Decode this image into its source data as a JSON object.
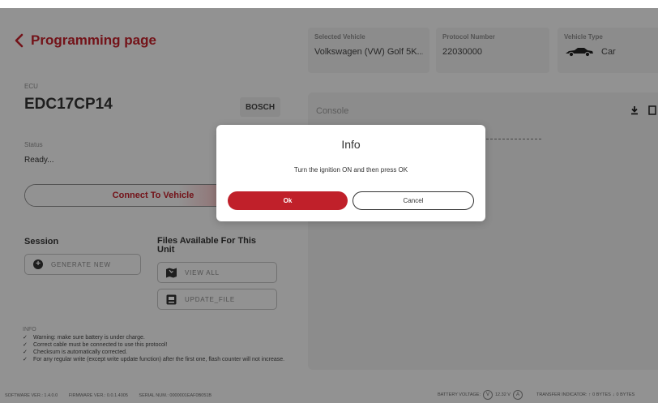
{
  "header": {
    "title": "Programming page",
    "selected_vehicle": {
      "label": "Selected Vehicle",
      "value": "Volkswagen (VW) Golf 5K..."
    },
    "protocol_number": {
      "label": "Protocol Number",
      "value": "22030000"
    },
    "vehicle_type": {
      "label": "Vehicle Type",
      "value": "Car",
      "icon": "car-icon"
    }
  },
  "ecu": {
    "label": "ECU",
    "name": "EDC17CP14",
    "brand": "BOSCH"
  },
  "status": {
    "label": "Status",
    "value": "Ready..."
  },
  "connect_button": {
    "label": "Connect To Vehicle",
    "progress": 1.0
  },
  "session": {
    "title": "Session",
    "generate_label": "GENERATE NEW"
  },
  "files": {
    "title": "Files Available For This Unit",
    "view_all_label": "VIEW ALL",
    "update_file_label": "UPDATE_FILE"
  },
  "info": {
    "label": "INFO",
    "lines": [
      "Warning: make sure battery is under charge.",
      "Correct cable must be connected to use this protocol!",
      "Checksum is automatically corrected.",
      "For any regular write (except write update function) after the first one, flash counter will not increase."
    ]
  },
  "console": {
    "title": "Console"
  },
  "footer": {
    "software": "SOFTWARE VER.: 1.4.0.0",
    "firmware": "FIRMWARE VER.: 0.0.1.4005",
    "serial": "SERIAL NUM.: 0000001EAF0B051B",
    "battery_label": "BATTERY VOLTAGE:",
    "battery_value": "12.32 V",
    "transfer_label": "TRANSFER INDICATOR:",
    "transfer_up": "0 BYTES",
    "transfer_down": "0 BYTES"
  },
  "dialog": {
    "title": "Info",
    "message": "Turn the ignition ON and then press OK",
    "ok_label": "Ok",
    "cancel_label": "Cancel"
  },
  "colors": {
    "accent": "#c0202a"
  }
}
